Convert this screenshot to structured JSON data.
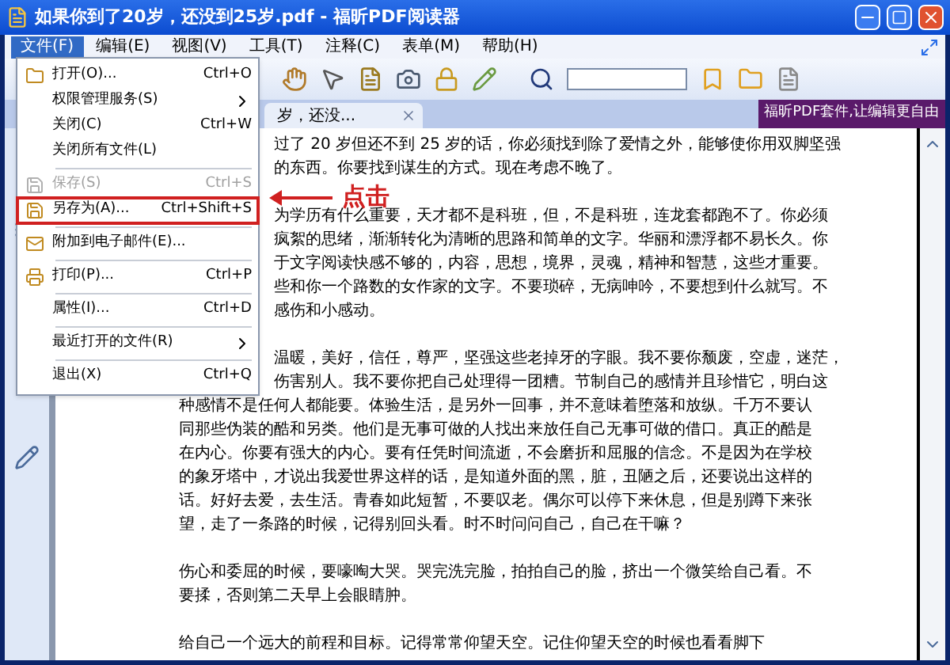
{
  "window": {
    "title": "如果你到了20岁，还没到25岁.pdf - 福昕PDF阅读器"
  },
  "menu_bar": [
    {
      "label": "文件(F)",
      "selected": true
    },
    {
      "label": "编辑(E)",
      "selected": false
    },
    {
      "label": "视图(V)",
      "selected": false
    },
    {
      "label": "工具(T)",
      "selected": false
    },
    {
      "label": "注释(C)",
      "selected": false
    },
    {
      "label": "表单(M)",
      "selected": false
    },
    {
      "label": "帮助(H)",
      "selected": false
    }
  ],
  "file_menu": [
    {
      "kind": "open",
      "label": "打开(O)...",
      "shortcut": "Ctrl+O",
      "disabled": false,
      "submenu": false,
      "annotated": false
    },
    {
      "kind": "item",
      "label": "权限管理服务(S)",
      "disabled": false,
      "submenu": true,
      "annotated": false
    },
    {
      "kind": "item",
      "label": "关闭(C)",
      "shortcut": "Ctrl+W",
      "disabled": false,
      "submenu": false,
      "annotated": false
    },
    {
      "kind": "item",
      "label": "关闭所有文件(L)",
      "disabled": false,
      "submenu": false,
      "annotated": false
    },
    {
      "kind": "separator"
    },
    {
      "kind": "save",
      "label": "保存(S)",
      "shortcut": "Ctrl+S",
      "disabled": true,
      "submenu": false,
      "annotated": false
    },
    {
      "kind": "save",
      "label": "另存为(A)...",
      "shortcut": "Ctrl+Shift+S",
      "disabled": false,
      "submenu": false,
      "annotated": true
    },
    {
      "kind": "separator"
    },
    {
      "kind": "email",
      "label": "附加到电子邮件(E)...",
      "disabled": false,
      "submenu": false,
      "annotated": false
    },
    {
      "kind": "separator"
    },
    {
      "kind": "print",
      "label": "打印(P)...",
      "shortcut": "Ctrl+P",
      "disabled": false,
      "submenu": false,
      "annotated": false
    },
    {
      "kind": "separator"
    },
    {
      "kind": "item",
      "label": "属性(I)...",
      "shortcut": "Ctrl+D",
      "disabled": false,
      "submenu": false,
      "annotated": false
    },
    {
      "kind": "separator"
    },
    {
      "kind": "item",
      "label": "最近打开的文件(R)",
      "disabled": false,
      "submenu": true,
      "annotated": false
    },
    {
      "kind": "separator"
    },
    {
      "kind": "item",
      "label": "退出(X)",
      "shortcut": "Ctrl+Q",
      "disabled": false,
      "submenu": false,
      "annotated": false
    }
  ],
  "annotation": {
    "label": "点击"
  },
  "tab": {
    "label": "岁，还没..."
  },
  "promo_banner": {
    "label": "福昕PDF套件,让编辑更自由"
  },
  "document": {
    "paragraphs": [
      {
        "lines": [
          {
            "text": "过了 20 岁但还不到 25 岁的话，你必须找到除了爱情之外，能够使你用双脚坚强",
            "covered": true
          },
          {
            "text": "的东西。你要找到谋生的方式。现在考虑不晚了。",
            "covered": true
          }
        ]
      },
      {
        "lines": [
          {
            "text": "为学历有什么重要，天才都不是科班，但，不是科班，连龙套都跑不了。你必须",
            "covered": true
          },
          {
            "text": "疯絮的思绪，渐渐转化为清晰的思路和简单的文字。华丽和漂浮都不易长久。你",
            "covered": true
          },
          {
            "text": "于文字阅读快感不够的，内容，思想，境界，灵魂，精神和智慧，这些才重要。",
            "covered": true
          },
          {
            "text": "些和你一个路数的女作家的文字。不要琐碎，无病呻吟，不要想到什么就写。不",
            "covered": true
          },
          {
            "text": "感伤和小感动。",
            "covered": true
          }
        ]
      },
      {
        "lines": [
          {
            "text": "温暖，美好，信任，尊严，坚强这些老掉牙的字眼。我不要你颓废，空虚，迷茫，",
            "covered": true
          },
          {
            "text": "伤害别人。我不要你把自己处理得一团糟。节制自己的感情并且珍惜它，明白这",
            "covered": true
          },
          {
            "text": "种感情不是任何人都能要。体验生活，是另外一回事，并不意味着堕落和放纵。千万不要认"
          },
          {
            "text": "同那些伪装的酷和另类。他们是无事可做的人找出来放任自己无事可做的借口。真正的酷是"
          },
          {
            "text": "在内心。你要有强大的内心。要有任凭时间流逝，不会磨折和屈服的信念。不是因为在学校"
          },
          {
            "text": "的象牙塔中，才说出我爱世界这样的话，是知道外面的黑，脏，丑陋之后，还要说出这样的"
          },
          {
            "text": "话。好好去爱，去生活。青春如此短暂，不要叹老。偶尔可以停下来休息，但是别蹲下来张"
          },
          {
            "text": "望，走了一条路的时候，记得别回头看。时不时问问自己，自己在干嘛？"
          }
        ]
      },
      {
        "lines": [
          {
            "text": "伤心和委屈的时候，要嚎啕大哭。哭完洗完脸，拍拍自己的脸，挤出一个微笑给自己看。不"
          },
          {
            "text": "要揉，否则第二天早上会眼睛肿。"
          }
        ]
      },
      {
        "lines": [
          {
            "text": "给自己一个远大的前程和目标。记得常常仰望天空。记住仰望天空的时候也看看脚下"
          }
        ]
      }
    ]
  }
}
